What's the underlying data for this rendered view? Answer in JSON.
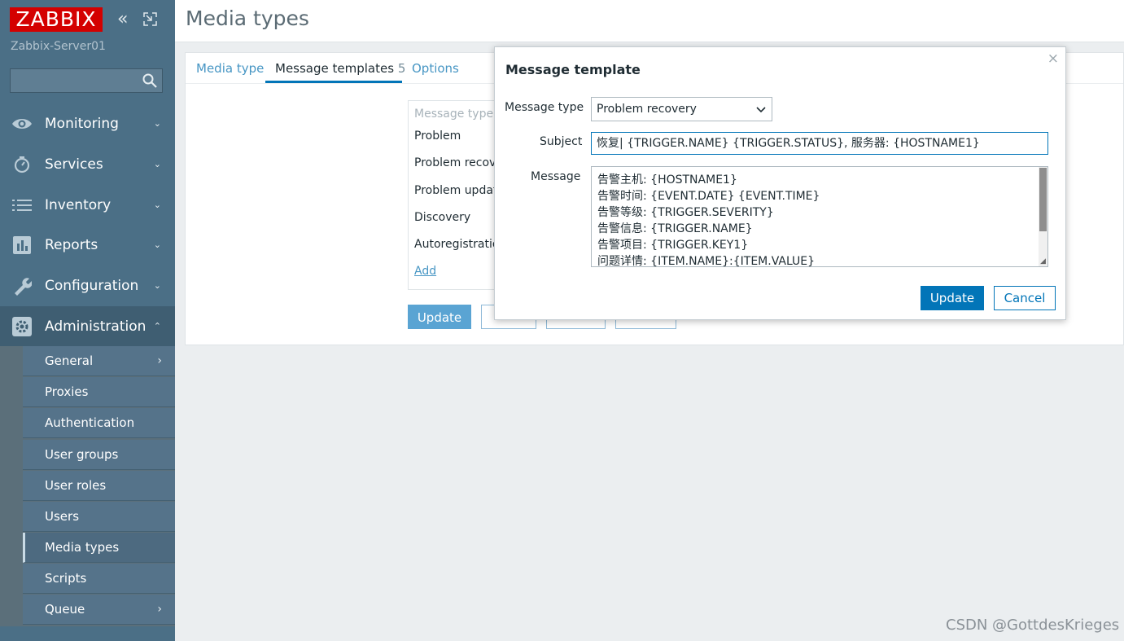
{
  "sidebar": {
    "logo": "ZABBIX",
    "server_name": "Zabbix-Server01",
    "search_placeholder": "",
    "menu": [
      {
        "label": "Monitoring",
        "icon": "eye-icon"
      },
      {
        "label": "Services",
        "icon": "stopwatch-icon"
      },
      {
        "label": "Inventory",
        "icon": "list-icon"
      },
      {
        "label": "Reports",
        "icon": "bar-chart-icon"
      },
      {
        "label": "Configuration",
        "icon": "wrench-icon"
      },
      {
        "label": "Administration",
        "icon": "gear-icon"
      }
    ],
    "submenu": [
      {
        "label": "General"
      },
      {
        "label": "Proxies"
      },
      {
        "label": "Authentication"
      },
      {
        "label": "User groups"
      },
      {
        "label": "User roles"
      },
      {
        "label": "Users"
      },
      {
        "label": "Media types"
      },
      {
        "label": "Scripts"
      },
      {
        "label": "Queue"
      }
    ]
  },
  "header": {
    "title": "Media types"
  },
  "tabs": {
    "media_type": "Media type",
    "message_templates": "Message templates",
    "message_templates_count": "5",
    "options": "Options"
  },
  "templates_table": {
    "header": "Message type",
    "rows": [
      "Problem",
      "Problem recove",
      "Problem update",
      "Discovery",
      "Autoregistration"
    ],
    "add": "Add"
  },
  "form_buttons": {
    "update": "Update"
  },
  "dialog": {
    "title": "Message template",
    "close": "×",
    "message_type_label": "Message type",
    "message_type_value": "Problem recovery",
    "subject_label": "Subject",
    "subject_value": "恢复| {TRIGGER.NAME} {TRIGGER.STATUS}, 服务器: {HOSTNAME1}",
    "message_label": "Message",
    "message_lines": [
      "告警主机: {HOSTNAME1}",
      "告警时间: {EVENT.DATE} {EVENT.TIME}",
      "告警等级: {TRIGGER.SEVERITY}",
      "告警信息: {TRIGGER.NAME}",
      "告警项目: {TRIGGER.KEY1}",
      "问题详情: {ITEM.NAME}:{ITEM.VALUE}"
    ],
    "update": "Update",
    "cancel": "Cancel"
  },
  "watermark": "CSDN @GottdesKrieges",
  "colors": {
    "logo": "#d40000",
    "sidebar": "#4b6f86",
    "accent": "#0275b8",
    "link": "#4796c4"
  }
}
